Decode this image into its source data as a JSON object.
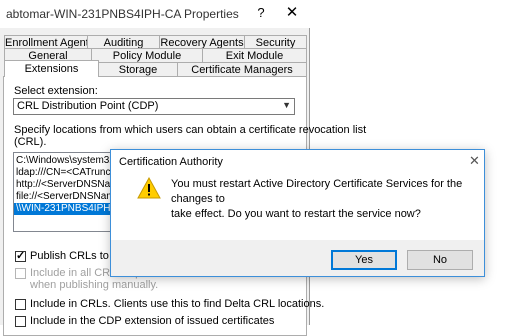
{
  "window": {
    "title": "abtomar-WIN-231PNBS4IPH-CA Properties",
    "help_glyph": "?",
    "close_glyph": "✕"
  },
  "tabs": {
    "row1": [
      "Enrollment Agents",
      "Auditing",
      "Recovery Agents",
      "Security"
    ],
    "row2": [
      "General",
      "Policy Module",
      "Exit Module"
    ],
    "row3": [
      "Extensions",
      "Storage",
      "Certificate Managers"
    ],
    "active": "Extensions"
  },
  "extensions": {
    "select_label": "Select extension:",
    "select_value": "CRL Distribution Point (CDP)",
    "desc_line1": "Specify locations from which users can obtain a certificate revocation list",
    "desc_line2": "(CRL).",
    "locations": [
      "C:\\Windows\\system32\\C",
      "ldap:///CN=<CATruncate",
      "http://<ServerDNSName",
      "file://<ServerDNSName>",
      "\\\\WIN-231PNBS4IPH\\C"
    ],
    "selected_location_index": 4,
    "cb_publish_crls": "Publish CRLs to this loc",
    "cb_publish_crls_checked": true,
    "cb_include_all_line1": "Include in all CRLs. Sp",
    "cb_include_all_line2": "when publishing manually.",
    "cb_include_all_checked": false,
    "cb_delta": "Include in CRLs. Clients use this to find Delta CRL locations.",
    "cb_delta_checked": false,
    "cb_cdp": "Include in the CDP extension of issued certificates",
    "cb_cdp_checked": false
  },
  "dialog": {
    "title": "Certification Authority",
    "close_glyph": "✕",
    "message_line1": "You must restart Active Directory Certificate Services for the changes to",
    "message_line2": "take effect. Do you want to restart the service now?",
    "yes_label": "Yes",
    "no_label": "No",
    "icon": "warning-icon"
  },
  "colors": {
    "selection": "#0078d7",
    "dialog_border": "#3d8fd9",
    "warning_yellow": "#ffcc00"
  }
}
